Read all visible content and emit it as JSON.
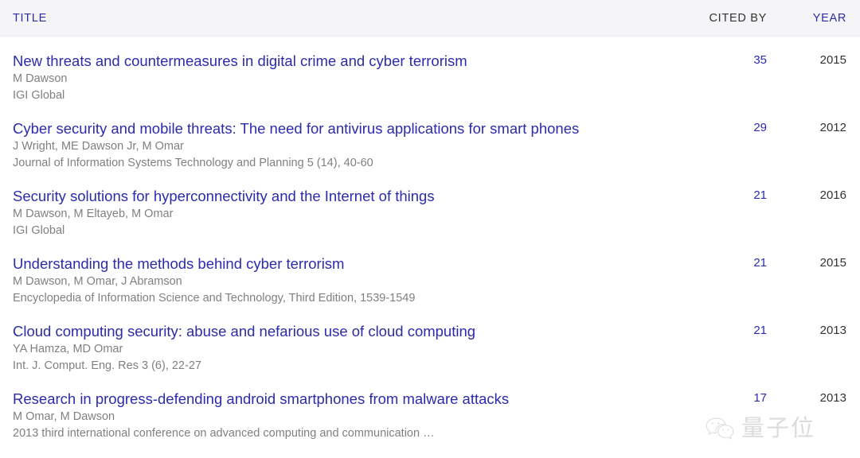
{
  "table": {
    "columns": {
      "title": "TITLE",
      "cited_by": "CITED BY",
      "year": "YEAR"
    },
    "rows": [
      {
        "title": "New threats and countermeasures in digital crime and cyber terrorism",
        "authors": "M Dawson",
        "venue": "IGI Global",
        "cited_by": "35",
        "year": "2015"
      },
      {
        "title": "Cyber security and mobile threats: The need for antivirus applications for smart phones",
        "authors": "J Wright, ME Dawson Jr, M Omar",
        "venue": "Journal of Information Systems Technology and Planning 5 (14), 40-60",
        "cited_by": "29",
        "year": "2012"
      },
      {
        "title": "Security solutions for hyperconnectivity and the Internet of things",
        "authors": "M Dawson, M Eltayeb, M Omar",
        "venue": "IGI Global",
        "cited_by": "21",
        "year": "2016"
      },
      {
        "title": "Understanding the methods behind cyber terrorism",
        "authors": "M Dawson, M Omar, J Abramson",
        "venue": "Encyclopedia of Information Science and Technology, Third Edition, 1539-1549",
        "cited_by": "21",
        "year": "2015"
      },
      {
        "title": "Cloud computing security: abuse and nefarious use of cloud computing",
        "authors": "YA Hamza, MD Omar",
        "venue": "Int. J. Comput. Eng. Res 3 (6), 22-27",
        "cited_by": "21",
        "year": "2013"
      },
      {
        "title": "Research in progress-defending android smartphones from malware attacks",
        "authors": "M Omar, M Dawson",
        "venue": "2013 third international conference on advanced computing and communication …",
        "cited_by": "17",
        "year": "2013"
      }
    ]
  },
  "watermark": {
    "text": "量子位",
    "icon": "wechat-icon"
  },
  "colors": {
    "link": "#2b2bab",
    "muted": "#808080",
    "header_bg": "#f5f5f7",
    "year_text": "#333333",
    "watermark": "#b9b9b9"
  }
}
